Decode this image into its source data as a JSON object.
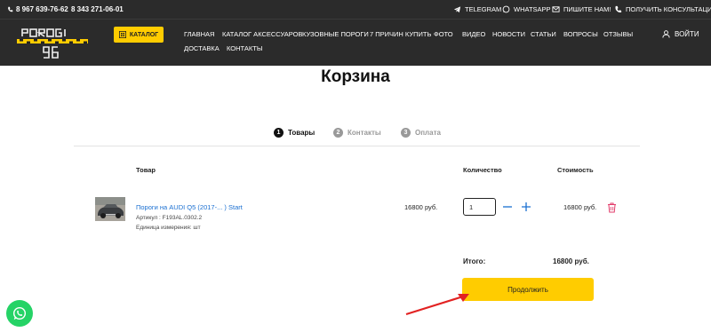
{
  "header": {
    "phones": [
      "8 967 639-76-62",
      "8 343 271-06-01"
    ],
    "contacts": {
      "telegram": "TELEGRAM",
      "whatsapp": "WHATSAPP",
      "write": "ПИШИТЕ НАМ!",
      "consult": "ПОЛУЧИТЬ КОНСУЛЬТАЦИЮ!"
    },
    "catalog_label": "КАТАЛОГ",
    "nav": [
      "ГЛАВНАЯ",
      "КАТАЛОГ АКСЕССУАРОВ",
      "КУЗОВНЫЕ ПОРОГИ",
      "7 ПРИЧИН КУПИТЬ",
      "ФОТО",
      "ВИДЕО",
      "НОВОСТИ",
      "СТАТЬИ",
      "ВОПРОСЫ",
      "ОТЗЫВЫ",
      "ДОСТАВКА",
      "КОНТАКТЫ"
    ],
    "login_label": "ВОЙТИ",
    "accent": "#ffcc00"
  },
  "cart": {
    "title": "Корзина",
    "steps": [
      {
        "num": "1",
        "label": "Товары",
        "active": true
      },
      {
        "num": "2",
        "label": "Контакты",
        "active": false
      },
      {
        "num": "3",
        "label": "Оплата",
        "active": false
      }
    ],
    "columns": {
      "product": "Товар",
      "quantity": "Количество",
      "cost": "Стоимость"
    },
    "item": {
      "name": "Пороги на AUDI Q5 (2017-... ) Start",
      "article": "Артикул : F193AL.0302.2",
      "unit": "Единица измерения: шт",
      "price": "16800 руб.",
      "quantity": "1",
      "cost": "16800 руб."
    },
    "total_label": "Итого:",
    "total_value": "16800 руб.",
    "continue_label": "Продолжить"
  }
}
